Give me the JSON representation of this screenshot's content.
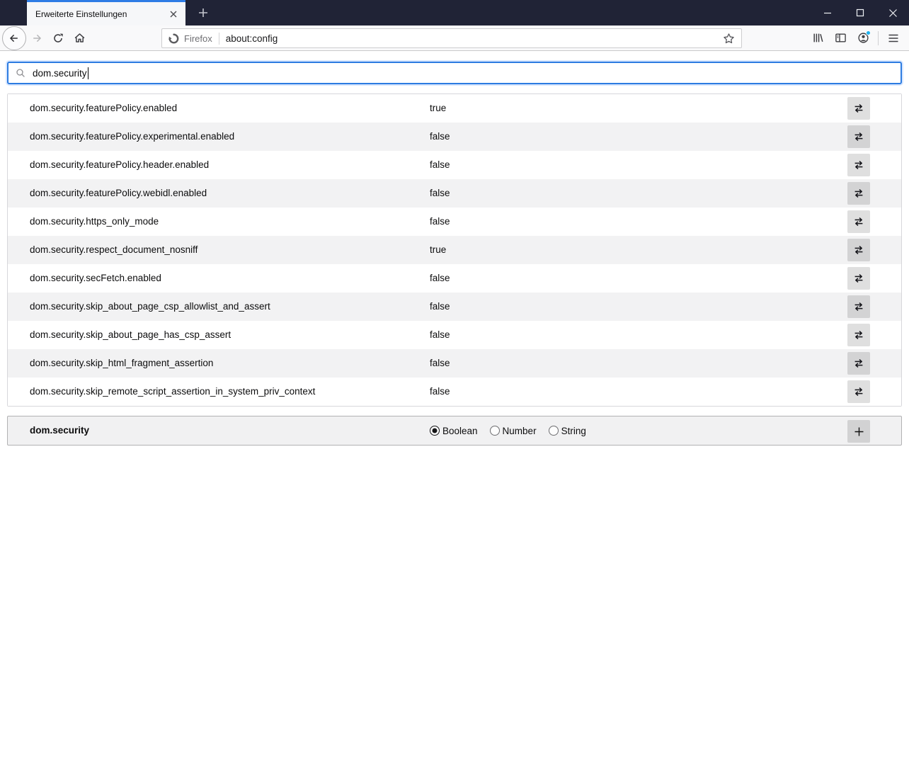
{
  "window": {
    "tab_title": "Erweiterte Einstellungen",
    "controls": [
      "minimize-icon",
      "maximize-icon",
      "close-icon"
    ]
  },
  "toolbar": {
    "identity_label": "Firefox",
    "url": "about:config"
  },
  "search": {
    "value": "dom.security"
  },
  "prefs": [
    {
      "name": "dom.security.featurePolicy.enabled",
      "value": "true"
    },
    {
      "name": "dom.security.featurePolicy.experimental.enabled",
      "value": "false"
    },
    {
      "name": "dom.security.featurePolicy.header.enabled",
      "value": "false"
    },
    {
      "name": "dom.security.featurePolicy.webidl.enabled",
      "value": "false"
    },
    {
      "name": "dom.security.https_only_mode",
      "value": "false"
    },
    {
      "name": "dom.security.respect_document_nosniff",
      "value": "true"
    },
    {
      "name": "dom.security.secFetch.enabled",
      "value": "false"
    },
    {
      "name": "dom.security.skip_about_page_csp_allowlist_and_assert",
      "value": "false"
    },
    {
      "name": "dom.security.skip_about_page_has_csp_assert",
      "value": "false"
    },
    {
      "name": "dom.security.skip_html_fragment_assertion",
      "value": "false"
    },
    {
      "name": "dom.security.skip_remote_script_assertion_in_system_priv_context",
      "value": "false"
    }
  ],
  "add_row": {
    "name": "dom.security",
    "types": [
      "Boolean",
      "Number",
      "String"
    ],
    "selected_type": "Boolean"
  },
  "icons": {
    "search": "magnifier",
    "pref_toggle": "swap-arrows",
    "add": "plus",
    "navigation": [
      "back-arrow",
      "forward-arrow",
      "reload",
      "home"
    ],
    "toolbar_right": [
      "library",
      "sidebar",
      "account",
      "menu"
    ]
  },
  "colors": {
    "tabbar_bg": "#202336",
    "tab_accent_stripe": "#2e7ce5",
    "toolbar_bg": "#f9f9fa",
    "search_focus_border": "#2d7ce1",
    "row_alt_bg": "#f2f2f3",
    "account_badge": "#1bb2f0"
  }
}
